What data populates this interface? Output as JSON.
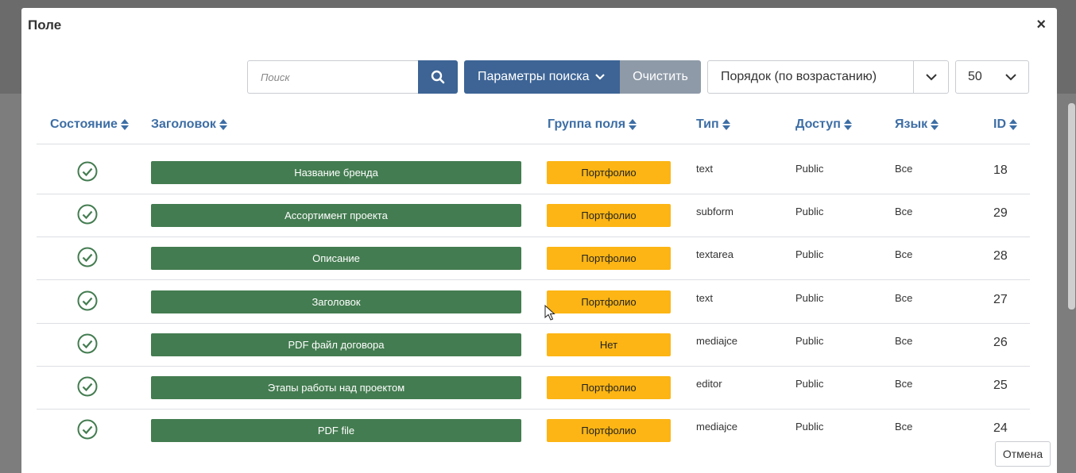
{
  "modal": {
    "title": "Поле",
    "close_label": "×"
  },
  "toolbar": {
    "search_placeholder": "Поиск",
    "search_icon": "search-icon",
    "params_label": "Параметры поиска",
    "clear_label": "Очистить",
    "order_value": "Порядок (по возрастанию)",
    "limit_value": "50"
  },
  "table": {
    "headers": {
      "state": "Состояние",
      "title": "Заголовок",
      "group": "Группа поля",
      "type": "Тип",
      "access": "Доступ",
      "language": "Язык",
      "id": "ID"
    },
    "rows": [
      {
        "title": "Название бренда",
        "group": "Портфолио",
        "type": "text",
        "access": "Public",
        "language": "Все",
        "id": "18"
      },
      {
        "title": "Ассортимент проекта",
        "group": "Портфолио",
        "type": "subform",
        "access": "Public",
        "language": "Все",
        "id": "29"
      },
      {
        "title": "Описание",
        "group": "Портфолио",
        "type": "textarea",
        "access": "Public",
        "language": "Все",
        "id": "28"
      },
      {
        "title": "Заголовок",
        "group": "Портфолио",
        "type": "text",
        "access": "Public",
        "language": "Все",
        "id": "27"
      },
      {
        "title": "PDF файл договора",
        "group": "Нет",
        "type": "mediajce",
        "access": "Public",
        "language": "Все",
        "id": "26"
      },
      {
        "title": "Этапы работы над проектом",
        "group": "Портфолио",
        "type": "editor",
        "access": "Public",
        "language": "Все",
        "id": "25"
      },
      {
        "title": "PDF file",
        "group": "Портфолио",
        "type": "mediajce",
        "access": "Public",
        "language": "Все",
        "id": "24"
      }
    ]
  },
  "footer": {
    "cancel_label": "Отмена"
  },
  "colors": {
    "primary": "#3d6495",
    "published": "#437c50",
    "group_badge": "#fcb514",
    "header_link": "#3d6ea5"
  }
}
